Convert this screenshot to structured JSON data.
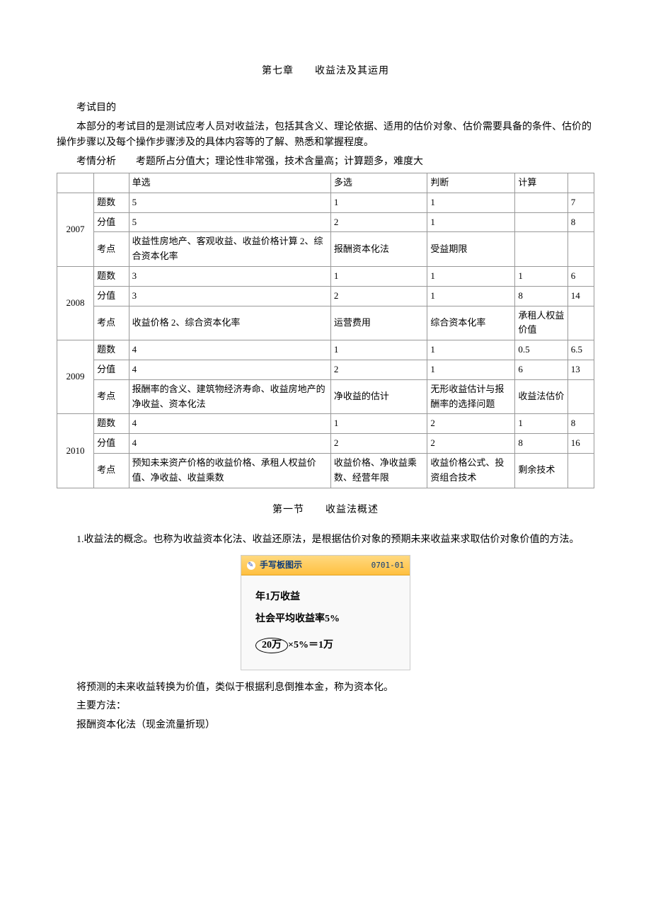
{
  "chapter": {
    "title": "第七章　　收益法及其运用"
  },
  "objective": {
    "heading": "考试目的",
    "text": "本部分的考试目的是测试应考人员对收益法，包括其含义、理论依据、适用的估价对象、估价需要具备的条件、估价的操作步骤以及每个操作步骤涉及的具体内容等的了解、熟悉和掌握程度。"
  },
  "analysis": {
    "prefix": "考情分析",
    "text": "考题所占分值大；理论性非常强，技术含量高；计算题多，难度大"
  },
  "table": {
    "headers": {
      "single": "单选",
      "multi": "多选",
      "judge": "判断",
      "calc": "计算"
    },
    "row_labels": {
      "count": "题数",
      "score": "分值",
      "point": "考点"
    },
    "years": [
      {
        "year": "2007",
        "count": {
          "single": "5",
          "multi": "1",
          "judge": "1",
          "calc": "",
          "total": "7"
        },
        "score": {
          "single": "5",
          "multi": "2",
          "judge": "1",
          "calc": "",
          "total": "8"
        },
        "point": {
          "single": "收益性房地产、客观收益、收益价格计算 2、综合资本化率",
          "multi": "报酬资本化法",
          "judge": "受益期限",
          "calc": "",
          "total": ""
        }
      },
      {
        "year": "2008",
        "count": {
          "single": "3",
          "multi": "1",
          "judge": "1",
          "calc": "1",
          "total": "6"
        },
        "score": {
          "single": "3",
          "multi": "2",
          "judge": "1",
          "calc": "8",
          "total": "14"
        },
        "point": {
          "single": "收益价格 2、综合资本化率",
          "multi": "运营费用",
          "judge": "综合资本化率",
          "calc": "承租人权益价值",
          "total": ""
        }
      },
      {
        "year": "2009",
        "count": {
          "single": "4",
          "multi": "1",
          "judge": "1",
          "calc": "0.5",
          "total": "6.5"
        },
        "score": {
          "single": "4",
          "multi": "2",
          "judge": "1",
          "calc": "6",
          "total": "13"
        },
        "point": {
          "single": "报酬率的含义、建筑物经济寿命、收益房地产的净收益、资本化法",
          "multi": "净收益的估计",
          "judge": "无形收益估计与报酬率的选择问题",
          "calc": "收益法估价",
          "total": ""
        }
      },
      {
        "year": "2010",
        "count": {
          "single": "4",
          "multi": "1",
          "judge": "2",
          "calc": "1",
          "total": "8"
        },
        "score": {
          "single": "4",
          "multi": "2",
          "judge": "2",
          "calc": "8",
          "total": "16"
        },
        "point": {
          "single": "预知未来资产价格的收益价格、承租人权益价值、净收益、收益乘数",
          "multi": "收益价格、净收益乘数、经营年限",
          "judge": "收益价格公式、投资组合技术",
          "calc": "剩余技术",
          "total": ""
        }
      }
    ]
  },
  "section1": {
    "title": "第一节　　收益法概述",
    "p1": "1.收益法的概念。也称为收益资本化法、收益还原法，是根据估价对象的预期未来收益来求取估价对象价值的方法。",
    "illustration": {
      "header_label": "手写板图示",
      "code": "0701-01",
      "line1": "年1万收益",
      "line2": "社会平均收益率5%",
      "line3_circled": "20万",
      "line3_rest": "×5%＝1万"
    },
    "p2": "将预测的未来收益转换为价值，类似于根据利息倒推本金，称为资本化。",
    "p3": "主要方法：",
    "p4": "报酬资本化法（现金流量折现）"
  }
}
